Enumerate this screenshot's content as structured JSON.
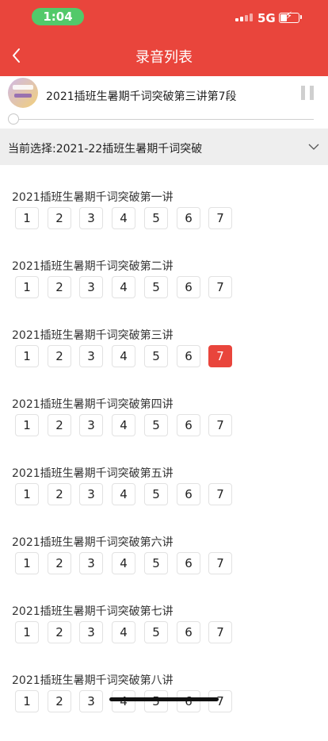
{
  "status_bar": {
    "time": "1:04",
    "network": "5G"
  },
  "nav": {
    "title": "录音列表"
  },
  "player": {
    "track_title": "2021插班生暑期千词突破第三讲第7段",
    "progress": 0.0
  },
  "selector": {
    "label": "当前选择:2021-22插班生暑期千词突破"
  },
  "sections": [
    {
      "title": "2021插班生暑期千词突破第一讲",
      "segments": [
        "1",
        "2",
        "3",
        "4",
        "5",
        "6",
        "7"
      ]
    },
    {
      "title": "2021插班生暑期千词突破第二讲",
      "segments": [
        "1",
        "2",
        "3",
        "4",
        "5",
        "6",
        "7"
      ]
    },
    {
      "title": "2021插班生暑期千词突破第三讲",
      "segments": [
        "1",
        "2",
        "3",
        "4",
        "5",
        "6",
        "7"
      ],
      "active_segment": "7"
    },
    {
      "title": "2021插班生暑期千词突破第四讲",
      "segments": [
        "1",
        "2",
        "3",
        "4",
        "5",
        "6",
        "7"
      ]
    },
    {
      "title": "2021插班生暑期千词突破第五讲",
      "segments": [
        "1",
        "2",
        "3",
        "4",
        "5",
        "6",
        "7"
      ]
    },
    {
      "title": "2021插班生暑期千词突破第六讲",
      "segments": [
        "1",
        "2",
        "3",
        "4",
        "5",
        "6",
        "7"
      ]
    },
    {
      "title": "2021插班生暑期千词突破第七讲",
      "segments": [
        "1",
        "2",
        "3",
        "4",
        "5",
        "6",
        "7"
      ]
    },
    {
      "title": "2021插班生暑期千词突破第八讲",
      "segments": [
        "1",
        "2",
        "3",
        "4",
        "5",
        "6",
        "7"
      ]
    }
  ],
  "colors": {
    "accent": "#e9453c",
    "time_pill": "#52c96a",
    "selector_bg": "#eeeeee"
  },
  "icons": {
    "back": "chevron-left-icon",
    "pause": "pause-icon",
    "dropdown": "chevron-down-icon",
    "battery": "battery-charging-icon"
  }
}
